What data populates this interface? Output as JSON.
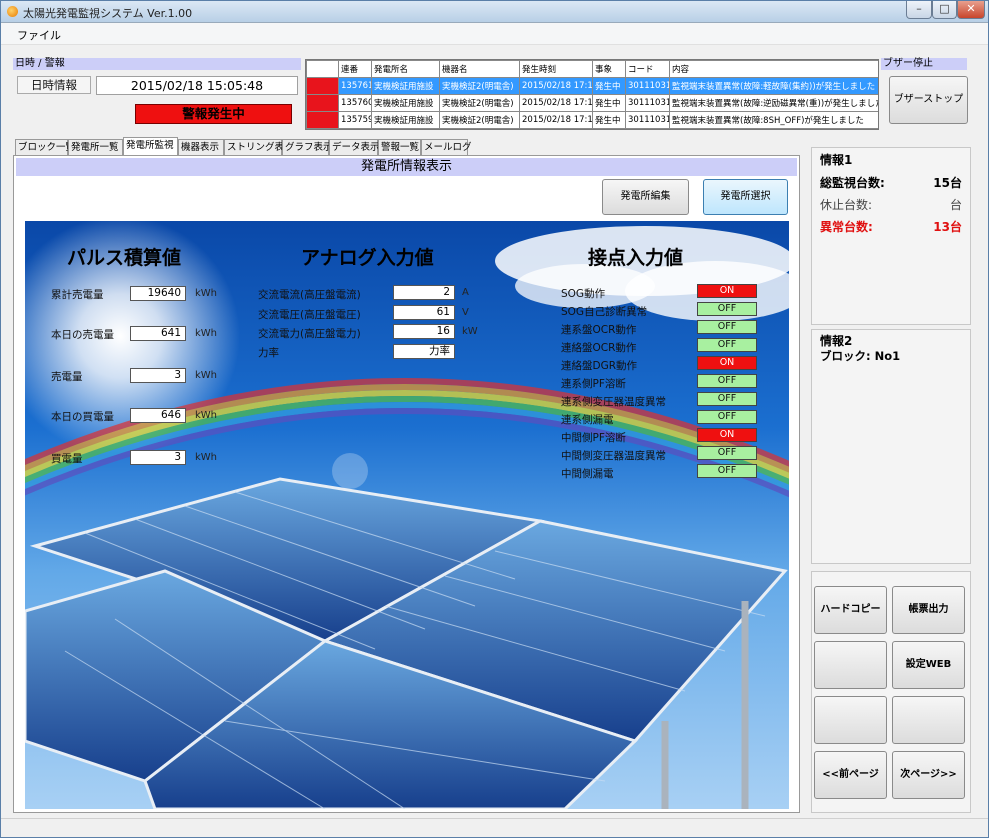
{
  "window": {
    "title": "太陽光発電監視システム Ver.1.00"
  },
  "menu": {
    "file": "ファイル"
  },
  "datetime": {
    "group_label": "日時 / 警報",
    "label": "日時情報",
    "value": "2015/02/18 15:05:48",
    "alarm": "警報発生中"
  },
  "buzzer": {
    "group_label": "ブザー停止",
    "button": "ブザーストップ"
  },
  "alarm_table": {
    "headers": [
      "",
      "連番",
      "発電所名",
      "機器名",
      "発生時刻",
      "事象",
      "コード",
      "内容"
    ],
    "rows": [
      [
        "",
        "135761",
        "実機検証用施設",
        "実機検証2(明電舎)",
        "2015/02/18 17:10",
        "発生中",
        "301110314",
        "監視端末装置異常(故障:軽故障(集約))が発生しました"
      ],
      [
        "",
        "135760",
        "実機検証用施設",
        "実機検証2(明電舎)",
        "2015/02/18 17:10",
        "発生中",
        "301110312",
        "監視端末装置異常(故障:逆励磁異常(重))が発生しました"
      ],
      [
        "",
        "135759",
        "実機検証用施設",
        "実機検証2(明電舎)",
        "2015/02/18 17:10",
        "発生中",
        "301110310",
        "監視端末装置異常(故障:8SH_OFF)が発生しました"
      ]
    ]
  },
  "tabs": [
    "ブロック一覧",
    "発電所一覧",
    "発電所監視",
    "機器表示",
    "ストリング表示",
    "グラフ表示",
    "データ表示",
    "警報一覧",
    "メールログ"
  ],
  "active_tab": 2,
  "main": {
    "header": "発電所情報表示",
    "edit_button": "発電所編集",
    "select_button": "発電所選択"
  },
  "pulse": {
    "title": "パルス積算値",
    "items": [
      {
        "label": "累計売電量",
        "value": "19640",
        "unit": "kWh"
      },
      {
        "label": "本日の売電量",
        "value": "641",
        "unit": "kWh"
      },
      {
        "label": "売電量",
        "value": "3",
        "unit": "kWh"
      },
      {
        "label": "本日の買電量",
        "value": "646",
        "unit": "kWh"
      },
      {
        "label": "買電量",
        "value": "3",
        "unit": "kWh"
      }
    ]
  },
  "analog": {
    "title": "アナログ入力値",
    "items": [
      {
        "label": "交流電流(高圧盤電流)",
        "value": "2",
        "unit": "A"
      },
      {
        "label": "交流電圧(高圧盤電圧)",
        "value": "61",
        "unit": "V"
      },
      {
        "label": "交流電力(高圧盤電力)",
        "value": "16",
        "unit": "kW"
      },
      {
        "label": "力率",
        "value": "力率",
        "unit": ""
      }
    ]
  },
  "contact": {
    "title": "接点入力値",
    "items": [
      {
        "label": "SOG動作",
        "state": "ON"
      },
      {
        "label": "SOG自己診断異常",
        "state": "OFF"
      },
      {
        "label": "連系盤OCR動作",
        "state": "OFF"
      },
      {
        "label": "連絡盤OCR動作",
        "state": "OFF"
      },
      {
        "label": "連絡盤DGR動作",
        "state": "ON"
      },
      {
        "label": "連系側PF溶断",
        "state": "OFF"
      },
      {
        "label": "連系側変圧器温度異常",
        "state": "OFF"
      },
      {
        "label": "連系側漏電",
        "state": "OFF"
      },
      {
        "label": "中間側PF溶断",
        "state": "ON"
      },
      {
        "label": "中間側変圧器温度異常",
        "state": "OFF"
      },
      {
        "label": "中間側漏電",
        "state": "OFF"
      }
    ]
  },
  "info1": {
    "title": "情報1",
    "total_label": "総監視台数:",
    "total_value": "15台",
    "stop_label": "休止台数:",
    "stop_value": "台",
    "abnormal_label": "異常台数:",
    "abnormal_value": "13台"
  },
  "info2": {
    "title": "情報2",
    "block": "ブロック: No1"
  },
  "side_buttons": {
    "hardcopy": "ハードコピー",
    "report": "帳票出力",
    "settings": "設定WEB",
    "prev": "<<前ページ",
    "next": "次ページ>>"
  },
  "colors": {
    "alarm_red": "#e8141c",
    "on_red": "#ef1010",
    "off_green": "#a8f0a0",
    "group_header": "#cccef8",
    "selected_row": "#3399ff"
  }
}
